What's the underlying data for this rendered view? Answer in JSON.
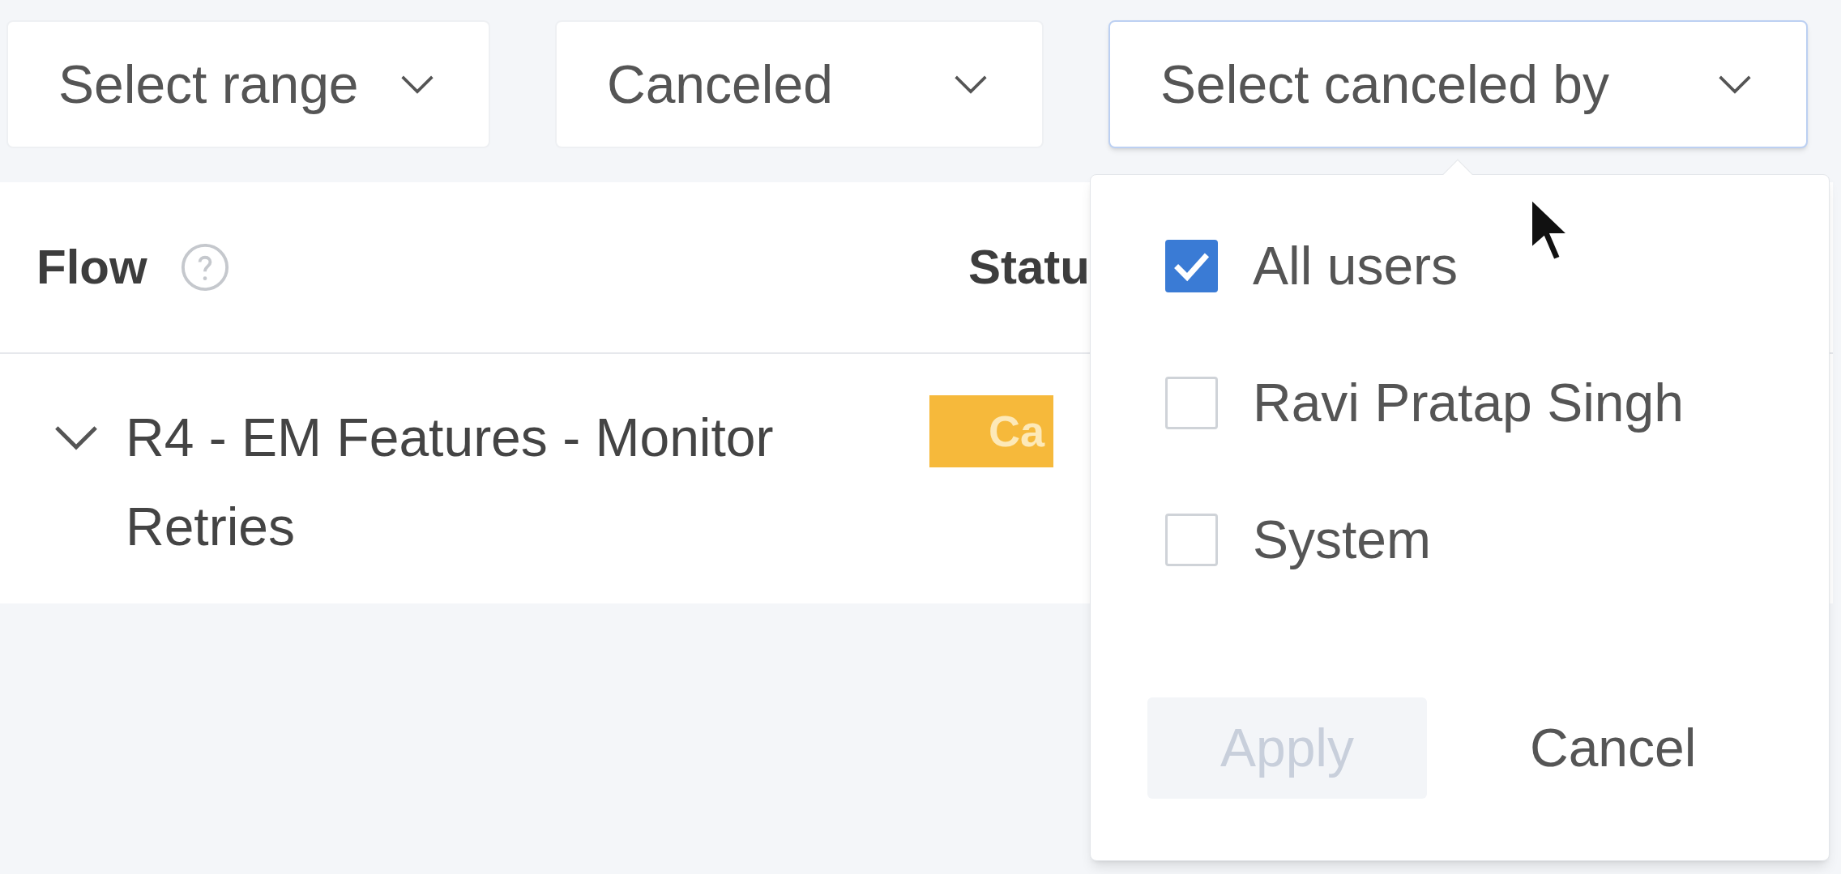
{
  "filters": [
    {
      "label": "Select range",
      "expanded": false
    },
    {
      "label": "Canceled",
      "expanded": false
    },
    {
      "label": "Select canceled by",
      "expanded": true
    }
  ],
  "table": {
    "columns": [
      {
        "label": "Flow",
        "help": true
      },
      {
        "label": "Statu"
      }
    ],
    "rows": [
      {
        "expanded": true,
        "flow": "R4 - EM Features - Monitor Retries",
        "status": "Ca",
        "color": "#f6b93b"
      }
    ]
  },
  "canceled_by_menu": {
    "options": [
      {
        "label": "All users",
        "checked": true
      },
      {
        "label": "Ravi Pratap Singh",
        "checked": false
      },
      {
        "label": "System",
        "checked": false
      }
    ],
    "buttons": [
      {
        "label": "Apply",
        "kind": "primary",
        "disabled": true
      },
      {
        "label": "Cancel",
        "kind": "link",
        "disabled": false
      }
    ]
  }
}
